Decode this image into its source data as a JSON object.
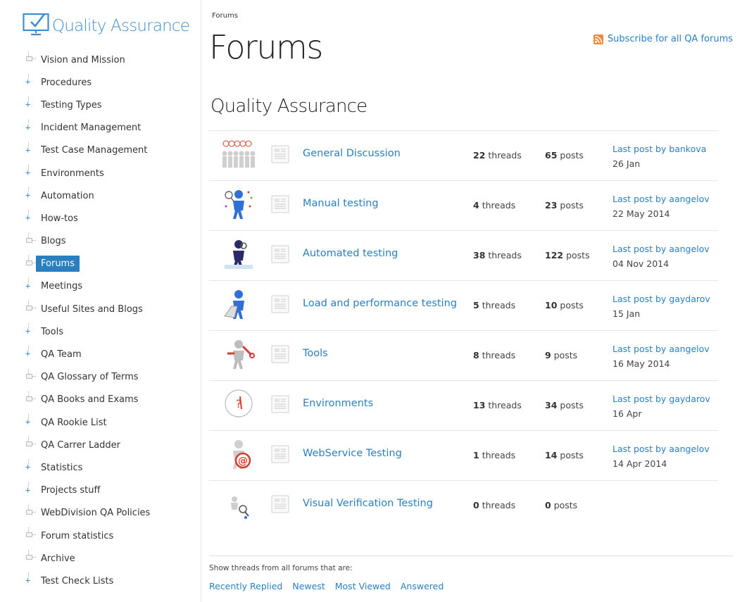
{
  "site": {
    "logo_text": "Quality Assurance"
  },
  "sidebar": {
    "items": [
      {
        "label": "Vision and Mission",
        "expandable": false,
        "active": false
      },
      {
        "label": "Procedures",
        "expandable": true,
        "active": false
      },
      {
        "label": "Testing Types",
        "expandable": true,
        "active": false
      },
      {
        "label": "Incident Management",
        "expandable": true,
        "active": false
      },
      {
        "label": "Test Case Management",
        "expandable": true,
        "active": false
      },
      {
        "label": "Environments",
        "expandable": true,
        "active": false
      },
      {
        "label": "Automation",
        "expandable": true,
        "active": false
      },
      {
        "label": "How-tos",
        "expandable": true,
        "active": false
      },
      {
        "label": "Blogs",
        "expandable": false,
        "active": false
      },
      {
        "label": "Forums",
        "expandable": false,
        "active": true
      },
      {
        "label": "Meetings",
        "expandable": true,
        "active": false
      },
      {
        "label": "Useful Sites and Blogs",
        "expandable": false,
        "active": false
      },
      {
        "label": "Tools",
        "expandable": true,
        "active": false
      },
      {
        "label": "QA Team",
        "expandable": true,
        "active": false
      },
      {
        "label": "QA Glossary of Terms",
        "expandable": false,
        "active": false
      },
      {
        "label": "QA Books and Exams",
        "expandable": false,
        "active": false
      },
      {
        "label": "QA Rookie List",
        "expandable": true,
        "active": false
      },
      {
        "label": "QA Carrer Ladder",
        "expandable": false,
        "active": false
      },
      {
        "label": "Statistics",
        "expandable": true,
        "active": false
      },
      {
        "label": "Projects stuff",
        "expandable": true,
        "active": false
      },
      {
        "label": "WebDivision QA Policies",
        "expandable": false,
        "active": false
      },
      {
        "label": "Forum statistics",
        "expandable": false,
        "active": false
      },
      {
        "label": "Archive",
        "expandable": false,
        "active": false
      },
      {
        "label": "Test Check Lists",
        "expandable": true,
        "active": false
      }
    ]
  },
  "main": {
    "breadcrumb": "Forums",
    "title": "Forums",
    "subscribe_label": "Subscribe for all QA forums",
    "section_title": "Quality Assurance",
    "forums": [
      {
        "name": "General Discussion",
        "threads": "22",
        "threads_label": "threads",
        "posts": "65",
        "posts_label": "posts",
        "last_post": "Last post by bankova",
        "date": "26 Jan",
        "thumb": "crowd-speech-bubbles-icon"
      },
      {
        "name": "Manual testing",
        "threads": "4",
        "threads_label": "threads",
        "posts": "23",
        "posts_label": "posts",
        "last_post": "Last post by aangelov",
        "date": "22 May 2014",
        "thumb": "butterfly-net-person-icon"
      },
      {
        "name": "Automated testing",
        "threads": "38",
        "threads_label": "threads",
        "posts": "122",
        "posts_label": "posts",
        "last_post": "Last post by aangelov",
        "date": "04 Nov 2014",
        "thumb": "robot-person-icon"
      },
      {
        "name": "Load and performance testing",
        "threads": "5",
        "threads_label": "threads",
        "posts": "10",
        "posts_label": "posts",
        "last_post": "Last post by gaydarov",
        "date": "15 Jan",
        "thumb": "person-on-chair-icon"
      },
      {
        "name": "Tools",
        "threads": "8",
        "threads_label": "threads",
        "posts": "9",
        "posts_label": "posts",
        "last_post": "Last post by aangelov",
        "date": "16 May 2014",
        "thumb": "person-with-wrench-icon"
      },
      {
        "name": "Environments",
        "threads": "13",
        "threads_label": "threads",
        "posts": "34",
        "posts_label": "posts",
        "last_post": "Last post by gaydarov",
        "date": "16 Apr",
        "thumb": "environment-badge-icon"
      },
      {
        "name": "WebService Testing",
        "threads": "1",
        "threads_label": "threads",
        "posts": "14",
        "posts_label": "posts",
        "last_post": "Last post by aangelov",
        "date": "14 Apr 2014",
        "thumb": "person-at-sign-icon"
      },
      {
        "name": "Visual Verification Testing",
        "threads": "0",
        "threads_label": "threads",
        "posts": "0",
        "posts_label": "posts",
        "last_post": "",
        "date": "",
        "thumb": "person-magnifier-icon"
      }
    ],
    "filter": {
      "caption": "Show threads from all forums that are:",
      "links": [
        "Recently Replied",
        "Newest",
        "Most Viewed",
        "Answered"
      ]
    }
  },
  "colors": {
    "link": "#2a7fc1",
    "active_bg": "#2a7fc1",
    "logo": "#3d8fd0",
    "rss": "#f0883a"
  }
}
